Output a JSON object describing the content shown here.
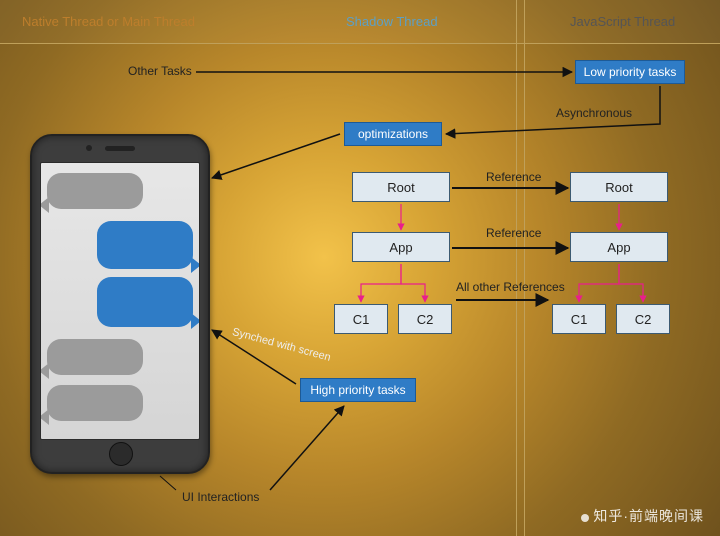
{
  "columns": {
    "native": "Native Thread or Main Thread",
    "shadow": "Shadow Thread",
    "js": "JavaScript Thread"
  },
  "labels": {
    "other_tasks": "Other Tasks",
    "asynchronous": "Asynchronous",
    "reference_root": "Reference",
    "reference_app": "Reference",
    "all_other_refs": "All other References",
    "synced_with_screen": "Synched with screen",
    "ui_interactions": "UI Interactions"
  },
  "blue_boxes": {
    "low_priority": "Low priority tasks",
    "optimizations": "optimizations",
    "high_priority": "High priority tasks"
  },
  "tree_shadow": {
    "root": "Root",
    "app": "App",
    "c1": "C1",
    "c2": "C2"
  },
  "tree_js": {
    "root": "Root",
    "app": "App",
    "c1": "C1",
    "c2": "C2"
  },
  "watermark": "知乎·前端晚间课"
}
